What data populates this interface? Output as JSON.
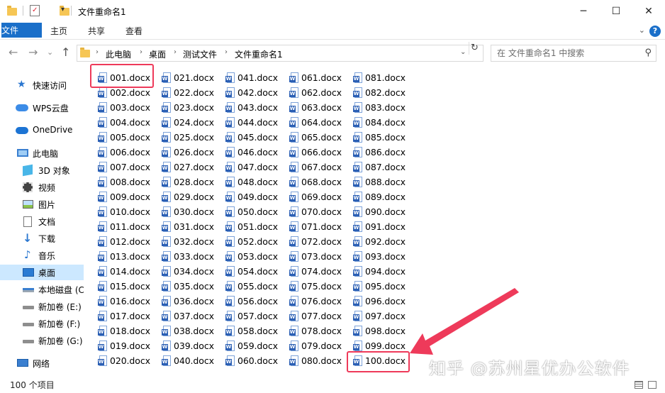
{
  "window": {
    "title": "文件重命名1",
    "minimize": "─",
    "maximize": "☐",
    "close": "✕"
  },
  "ribbon": {
    "tabs": [
      "文件",
      "主页",
      "共享",
      "查看"
    ],
    "expand": "⌄",
    "help": "?"
  },
  "nav": {
    "back": "←",
    "forward": "→",
    "recent": "⌄",
    "up": "↑"
  },
  "address": {
    "crumbs": [
      "此电脑",
      "桌面",
      "测试文件",
      "文件重命名1"
    ],
    "refresh": "↻"
  },
  "search": {
    "placeholder": "在 文件重命名1 中搜索"
  },
  "sidebar": {
    "items": [
      {
        "label": "快速访问",
        "icon": "star-icon"
      },
      {
        "label": "WPS云盘",
        "icon": "wps-cloud-icon"
      },
      {
        "label": "OneDrive",
        "icon": "onedrive-icon"
      },
      {
        "label": "此电脑",
        "icon": "computer-icon"
      },
      {
        "label": "3D 对象",
        "icon": "3d-objects-icon"
      },
      {
        "label": "视频",
        "icon": "video-icon"
      },
      {
        "label": "图片",
        "icon": "pictures-icon"
      },
      {
        "label": "文档",
        "icon": "documents-icon"
      },
      {
        "label": "下载",
        "icon": "download-icon"
      },
      {
        "label": "音乐",
        "icon": "music-icon"
      },
      {
        "label": "桌面",
        "icon": "desktop-icon",
        "selected": true
      },
      {
        "label": "本地磁盘 (C",
        "icon": "local-disk-icon"
      },
      {
        "label": "新加卷 (E:)",
        "icon": "drive-icon"
      },
      {
        "label": "新加卷 (F:)",
        "icon": "drive-icon"
      },
      {
        "label": "新加卷 (G:)",
        "icon": "drive-icon"
      },
      {
        "label": "网络",
        "icon": "network-icon"
      }
    ]
  },
  "files": {
    "columns": [
      [
        "001.docx",
        "002.docx",
        "003.docx",
        "004.docx",
        "005.docx",
        "006.docx",
        "007.docx",
        "008.docx",
        "009.docx",
        "010.docx",
        "011.docx",
        "012.docx",
        "013.docx",
        "014.docx",
        "015.docx",
        "016.docx",
        "017.docx",
        "018.docx",
        "019.docx",
        "020.docx"
      ],
      [
        "021.docx",
        "022.docx",
        "023.docx",
        "024.docx",
        "025.docx",
        "026.docx",
        "027.docx",
        "028.docx",
        "029.docx",
        "030.docx",
        "031.docx",
        "032.docx",
        "033.docx",
        "034.docx",
        "035.docx",
        "036.docx",
        "037.docx",
        "038.docx",
        "039.docx",
        "040.docx"
      ],
      [
        "041.docx",
        "042.docx",
        "043.docx",
        "044.docx",
        "045.docx",
        "046.docx",
        "047.docx",
        "048.docx",
        "049.docx",
        "050.docx",
        "051.docx",
        "052.docx",
        "053.docx",
        "054.docx",
        "055.docx",
        "056.docx",
        "057.docx",
        "058.docx",
        "059.docx",
        "060.docx"
      ],
      [
        "061.docx",
        "062.docx",
        "063.docx",
        "064.docx",
        "065.docx",
        "066.docx",
        "067.docx",
        "068.docx",
        "069.docx",
        "070.docx",
        "071.docx",
        "072.docx",
        "073.docx",
        "074.docx",
        "075.docx",
        "076.docx",
        "077.docx",
        "078.docx",
        "079.docx",
        "080.docx"
      ],
      [
        "081.docx",
        "082.docx",
        "083.docx",
        "084.docx",
        "085.docx",
        "086.docx",
        "087.docx",
        "088.docx",
        "089.docx",
        "090.docx",
        "091.docx",
        "092.docx",
        "093.docx",
        "094.docx",
        "095.docx",
        "096.docx",
        "097.docx",
        "098.docx",
        "099.docx",
        "100.docx"
      ]
    ],
    "icon": "word-docx-icon",
    "highlighted": [
      "001.docx",
      "100.docx"
    ]
  },
  "annotation": {
    "highlight_color": "#ee3a5a"
  },
  "watermark": "知乎 @苏州星优办公软件",
  "status": {
    "item_count": "100 个项目"
  },
  "colors": {
    "accent": "#1a6fc9",
    "selected": "#cce8ff"
  }
}
